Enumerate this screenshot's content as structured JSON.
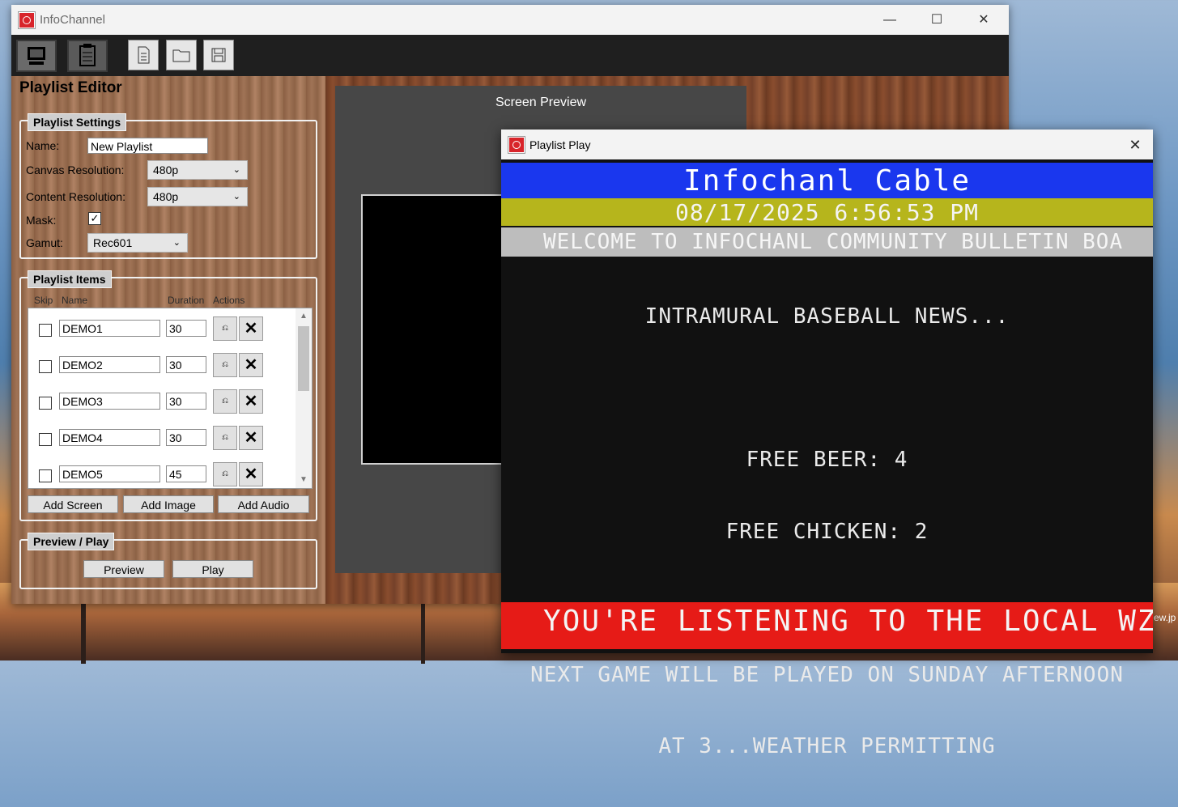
{
  "main_window": {
    "title": "InfoChannel",
    "controls": {
      "minimize": "—",
      "maximize": "☐",
      "close": "✕"
    }
  },
  "toolbar": {
    "buttons": [
      "monitor-icon",
      "clipboard-icon",
      "new-file-icon",
      "open-folder-icon",
      "save-icon"
    ]
  },
  "editor": {
    "title": "Playlist Editor",
    "settings": {
      "legend": "Playlist Settings",
      "name_label": "Name:",
      "name_value": "New Playlist",
      "canvas_label": "Canvas Resolution:",
      "canvas_value": "480p",
      "content_label": "Content Resolution:",
      "content_value": "480p",
      "mask_label": "Mask:",
      "mask_checked": "✓",
      "gamut_label": "Gamut:",
      "gamut_value": "Rec601"
    },
    "items": {
      "legend": "Playlist Items",
      "columns": [
        "Skip",
        "Name",
        "Duration",
        "Actions"
      ],
      "rows": [
        {
          "name": "DEMO1",
          "duration": "30"
        },
        {
          "name": "DEMO2",
          "duration": "30"
        },
        {
          "name": "DEMO3",
          "duration": "30"
        },
        {
          "name": "DEMO4",
          "duration": "30"
        },
        {
          "name": "DEMO5",
          "duration": "45"
        }
      ],
      "edit_glyph": "⎌",
      "delete_glyph": "✕",
      "add_screen": "Add Screen",
      "add_image": "Add Image",
      "add_audio": "Add Audio"
    },
    "preview_play": {
      "legend": "Preview / Play",
      "preview": "Preview",
      "play": "Play"
    }
  },
  "screen_preview": {
    "title": "Screen Preview"
  },
  "play_window": {
    "title": "Playlist Play",
    "close": "✕",
    "banner_title": "Infochanl Cable",
    "datetime": "08/17/2025 6:56:53 PM",
    "ticker_top": "WELCOME TO INFOCHANL COMMUNITY BULLETIN BOA",
    "body": [
      "INTRAMURAL BASEBALL NEWS...",
      "",
      "FREE BEER: 4",
      "FREE CHICKEN: 2",
      "",
      "NEXT GAME WILL BE PLAYED ON SUNDAY AFTERNOON",
      "AT 3...WEATHER PERMITTING"
    ],
    "ticker_bottom": "YOU'RE LISTENING TO THE LOCAL WZ"
  },
  "desktop": {
    "file_label": "ew.jp"
  },
  "colors": {
    "banner_blue": "#1a37ee",
    "date_band": "#b6b51c",
    "ticker_grey": "#bdbdbd",
    "ticker_red": "#e61b17"
  }
}
